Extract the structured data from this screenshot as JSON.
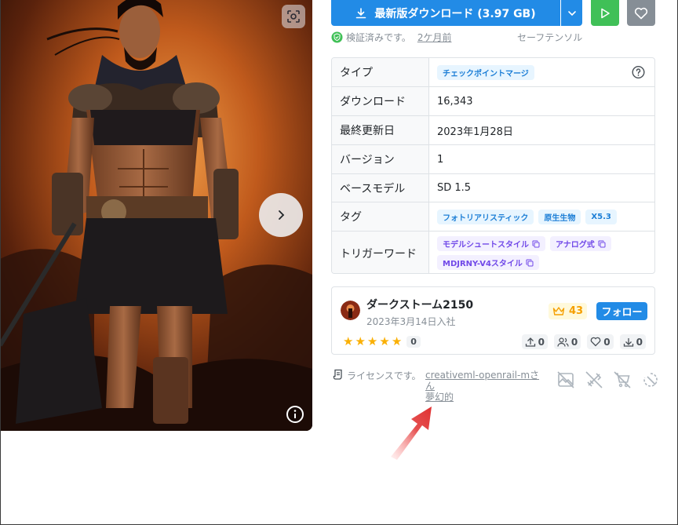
{
  "download": {
    "label": "最新版ダウンロード (3.97 GB)"
  },
  "verification": {
    "text": "検証済みです。",
    "time": "2ケ月前",
    "format": "セーフテンソル"
  },
  "details": {
    "type": {
      "key": "タイプ",
      "badge": "チェックポイントマージ"
    },
    "downloads": {
      "key": "ダウンロード",
      "value": "16,343"
    },
    "updated": {
      "key": "最終更新日",
      "value": "2023年1月28日"
    },
    "version": {
      "key": "バージョン",
      "value": "1"
    },
    "base_model": {
      "key": "ベースモデル",
      "value": "SD 1.5"
    },
    "tags": {
      "key": "タグ",
      "items": [
        "フォトリアリスティック",
        "原生生物",
        "X5.3"
      ]
    },
    "trigger_words": {
      "key": "トリガーワード",
      "items": [
        "モデルシュートスタイル",
        "アナログ式",
        "MDJRNY-V4スタイル"
      ]
    }
  },
  "creator": {
    "name": "ダークストーム2150",
    "joined": "2023年3月14日入社",
    "crown_count": "43",
    "follow_label": "フォロー",
    "rating_count": "0",
    "stats": {
      "uploads": "0",
      "followers": "0",
      "likes": "0",
      "downloads": "0"
    }
  },
  "license": {
    "label": "ライセンスです。",
    "link_line1": "creativeml-openrail-mさん",
    "link_line2": "夢幻的"
  },
  "colors": {
    "primary": "#228be6",
    "success": "#40c057",
    "gray": "#868e96",
    "star": "#fab005",
    "arrow": "#e03131"
  },
  "icons": [
    "scan-icon",
    "chevron-right-icon",
    "info-icon",
    "download-icon",
    "chevron-down-icon",
    "play-icon",
    "heart-icon",
    "shield-check-icon",
    "help-icon",
    "copy-icon",
    "crown-icon",
    "star-icon",
    "upload-icon",
    "users-icon",
    "heart-outline-icon",
    "download-small-icon",
    "license-icon",
    "no-image-sell-icon",
    "no-rent-icon",
    "no-cart-icon",
    "no-merge-icon"
  ]
}
